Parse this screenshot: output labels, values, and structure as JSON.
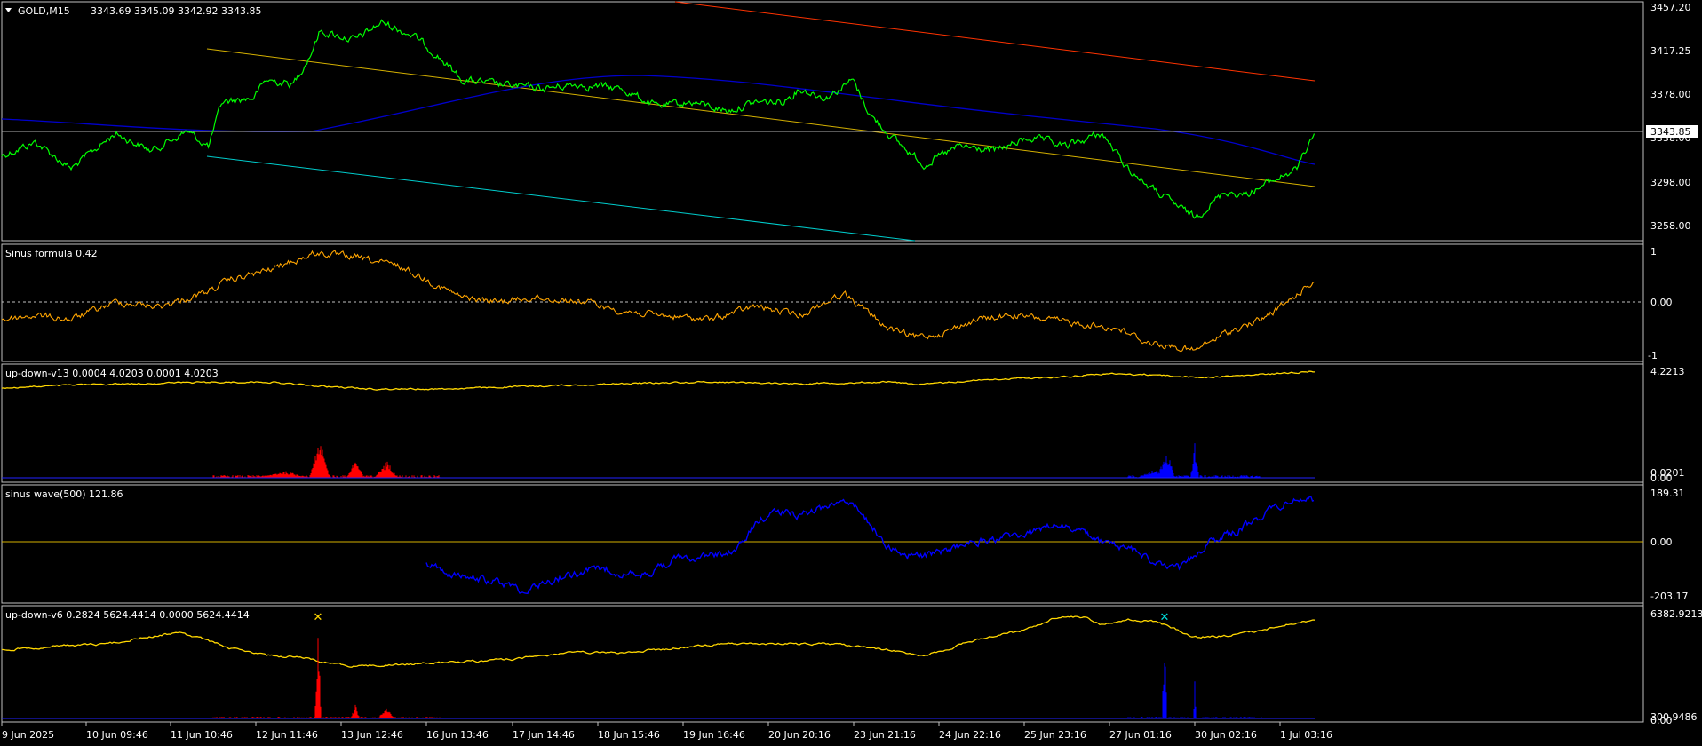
{
  "main": {
    "symbol_label": "GOLD,M15",
    "ohlc": "3343.69 3345.09 3342.92 3343.85",
    "price_ticks": [
      "3457.20",
      "3417.25",
      "3378.00",
      "3338.00",
      "3298.00",
      "3258.00"
    ],
    "current_price": "3343.85"
  },
  "panes": [
    {
      "title": "Sinus formula 0.42",
      "ticks": [
        "1",
        "0.00",
        "-1"
      ]
    },
    {
      "title": "up-down-v13 0.0004 4.0203 0.0001 4.0203",
      "ticks": [
        "4.2213",
        "0.0201",
        "0.00"
      ]
    },
    {
      "title": "sinus wave(500) 121.86",
      "ticks": [
        "189.31",
        "0.00",
        "-203.17"
      ]
    },
    {
      "title": "up-down-v6 0.2824 5624.4414 0.0000 5624.4414",
      "ticks": [
        "6382.9213",
        "300.9486",
        "0.00"
      ]
    }
  ],
  "time_axis": [
    "9 Jun 2025",
    "10 Jun 09:46",
    "11 Jun 10:46",
    "12 Jun 11:46",
    "13 Jun 12:46",
    "16 Jun 13:46",
    "17 Jun 14:46",
    "18 Jun 15:46",
    "19 Jun 16:46",
    "20 Jun 20:16",
    "23 Jun 21:16",
    "24 Jun 22:16",
    "25 Jun 23:16",
    "27 Jun 01:16",
    "30 Jun 02:16",
    "1 Jul 03:16"
  ],
  "colors": {
    "price_line": "#00ff00",
    "sinus_formula": "#ffa500",
    "up_line": "#ffd700",
    "up_histogram": "#ff0000",
    "down_histogram": "#0000ff",
    "sinus_wave": "#0000ff",
    "ma": "#0000cc",
    "channel_mid": "#d4b000",
    "channel_top": "#ff3300",
    "channel_bottom": "#00cccc",
    "grid": "#c0c0c0"
  }
}
